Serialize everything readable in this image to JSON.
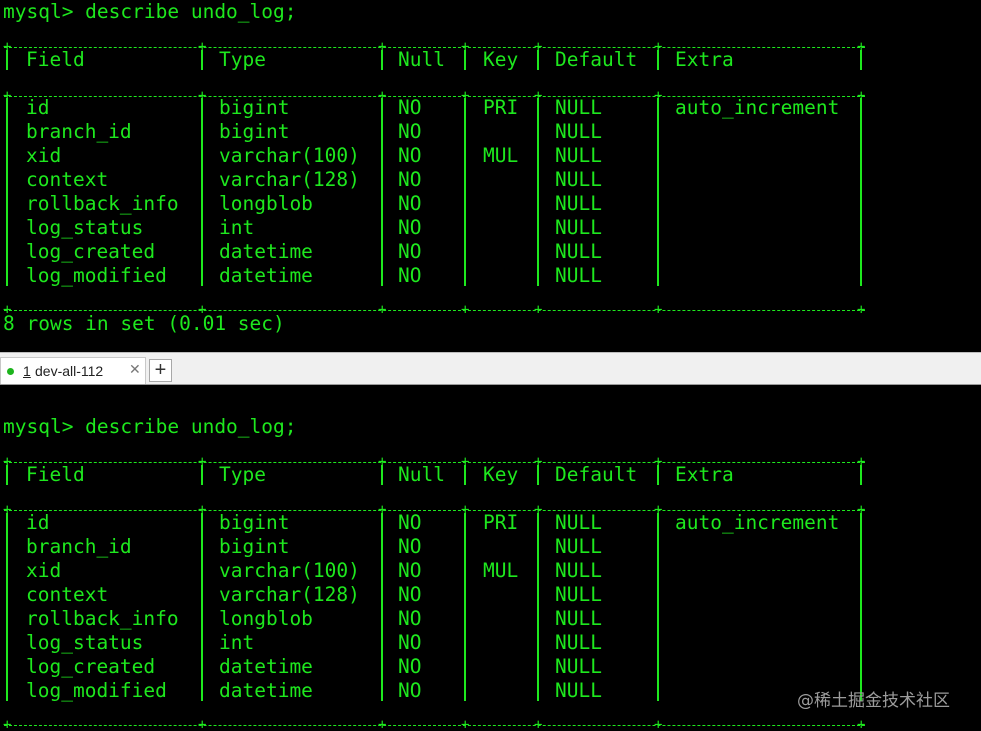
{
  "terminals": [
    {
      "prompt": "mysql> describe undo_log;",
      "columns": [
        "Field",
        "Type",
        "Null",
        "Key",
        "Default",
        "Extra"
      ],
      "rows": [
        [
          "id",
          "bigint",
          "NO",
          "PRI",
          "NULL",
          "auto_increment"
        ],
        [
          "branch_id",
          "bigint",
          "NO",
          "",
          "NULL",
          ""
        ],
        [
          "xid",
          "varchar(100)",
          "NO",
          "MUL",
          "NULL",
          ""
        ],
        [
          "context",
          "varchar(128)",
          "NO",
          "",
          "NULL",
          ""
        ],
        [
          "rollback_info",
          "longblob",
          "NO",
          "",
          "NULL",
          ""
        ],
        [
          "log_status",
          "int",
          "NO",
          "",
          "NULL",
          ""
        ],
        [
          "log_created",
          "datetime",
          "NO",
          "",
          "NULL",
          ""
        ],
        [
          "log_modified",
          "datetime",
          "NO",
          "",
          "NULL",
          ""
        ]
      ],
      "status": "8 rows in set (0.01 sec)"
    },
    {
      "prompt": "mysql> describe undo_log;",
      "columns": [
        "Field",
        "Type",
        "Null",
        "Key",
        "Default",
        "Extra"
      ],
      "rows": [
        [
          "id",
          "bigint",
          "NO",
          "PRI",
          "NULL",
          "auto_increment"
        ],
        [
          "branch_id",
          "bigint",
          "NO",
          "",
          "NULL",
          ""
        ],
        [
          "xid",
          "varchar(100)",
          "NO",
          "MUL",
          "NULL",
          ""
        ],
        [
          "context",
          "varchar(128)",
          "NO",
          "",
          "NULL",
          ""
        ],
        [
          "rollback_info",
          "longblob",
          "NO",
          "",
          "NULL",
          ""
        ],
        [
          "log_status",
          "int",
          "NO",
          "",
          "NULL",
          ""
        ],
        [
          "log_created",
          "datetime",
          "NO",
          "",
          "NULL",
          ""
        ],
        [
          "log_modified",
          "datetime",
          "NO",
          "",
          "NULL",
          ""
        ]
      ],
      "status": ""
    }
  ],
  "tabbar": {
    "tab_number": "1",
    "tab_label": "dev-all-112",
    "close_glyph": "✕",
    "add_glyph": "+",
    "status_color": "#1db41d"
  },
  "watermark": "@稀土掘金技术社区",
  "colors": {
    "terminal_text": "#1ee81e",
    "terminal_bg": "#000000"
  }
}
